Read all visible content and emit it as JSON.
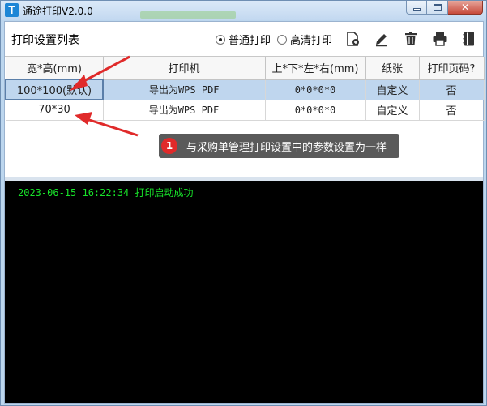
{
  "window": {
    "logo_letter": "T",
    "title": "通途打印V2.0.0"
  },
  "toolbar": {
    "title": "打印设置列表",
    "print_modes": [
      {
        "label": "普通打印",
        "checked": true
      },
      {
        "label": "高清打印",
        "checked": false
      }
    ],
    "icons": [
      "add-file-icon",
      "edit-icon",
      "delete-icon",
      "printer-icon",
      "notebook-icon"
    ]
  },
  "table": {
    "headers": [
      "宽*高(mm)",
      "打印机",
      "上*下*左*右(mm)",
      "纸张",
      "打印页码?"
    ],
    "rows": [
      [
        "100*100(默认)",
        "导出为WPS PDF",
        "0*0*0*0",
        "自定义",
        "否"
      ],
      [
        "70*30",
        "导出为WPS PDF",
        "0*0*0*0",
        "自定义",
        "否"
      ]
    ]
  },
  "console": {
    "log": "2023-06-15 16:22:34 打印启动成功"
  },
  "annotation": {
    "number": "1",
    "text": "与采购单管理打印设置中的参数设置为一样"
  },
  "colors": {
    "accent_red": "#e02a2a",
    "selected_row": "#bfd6ee",
    "console_text": "#18e22a"
  }
}
